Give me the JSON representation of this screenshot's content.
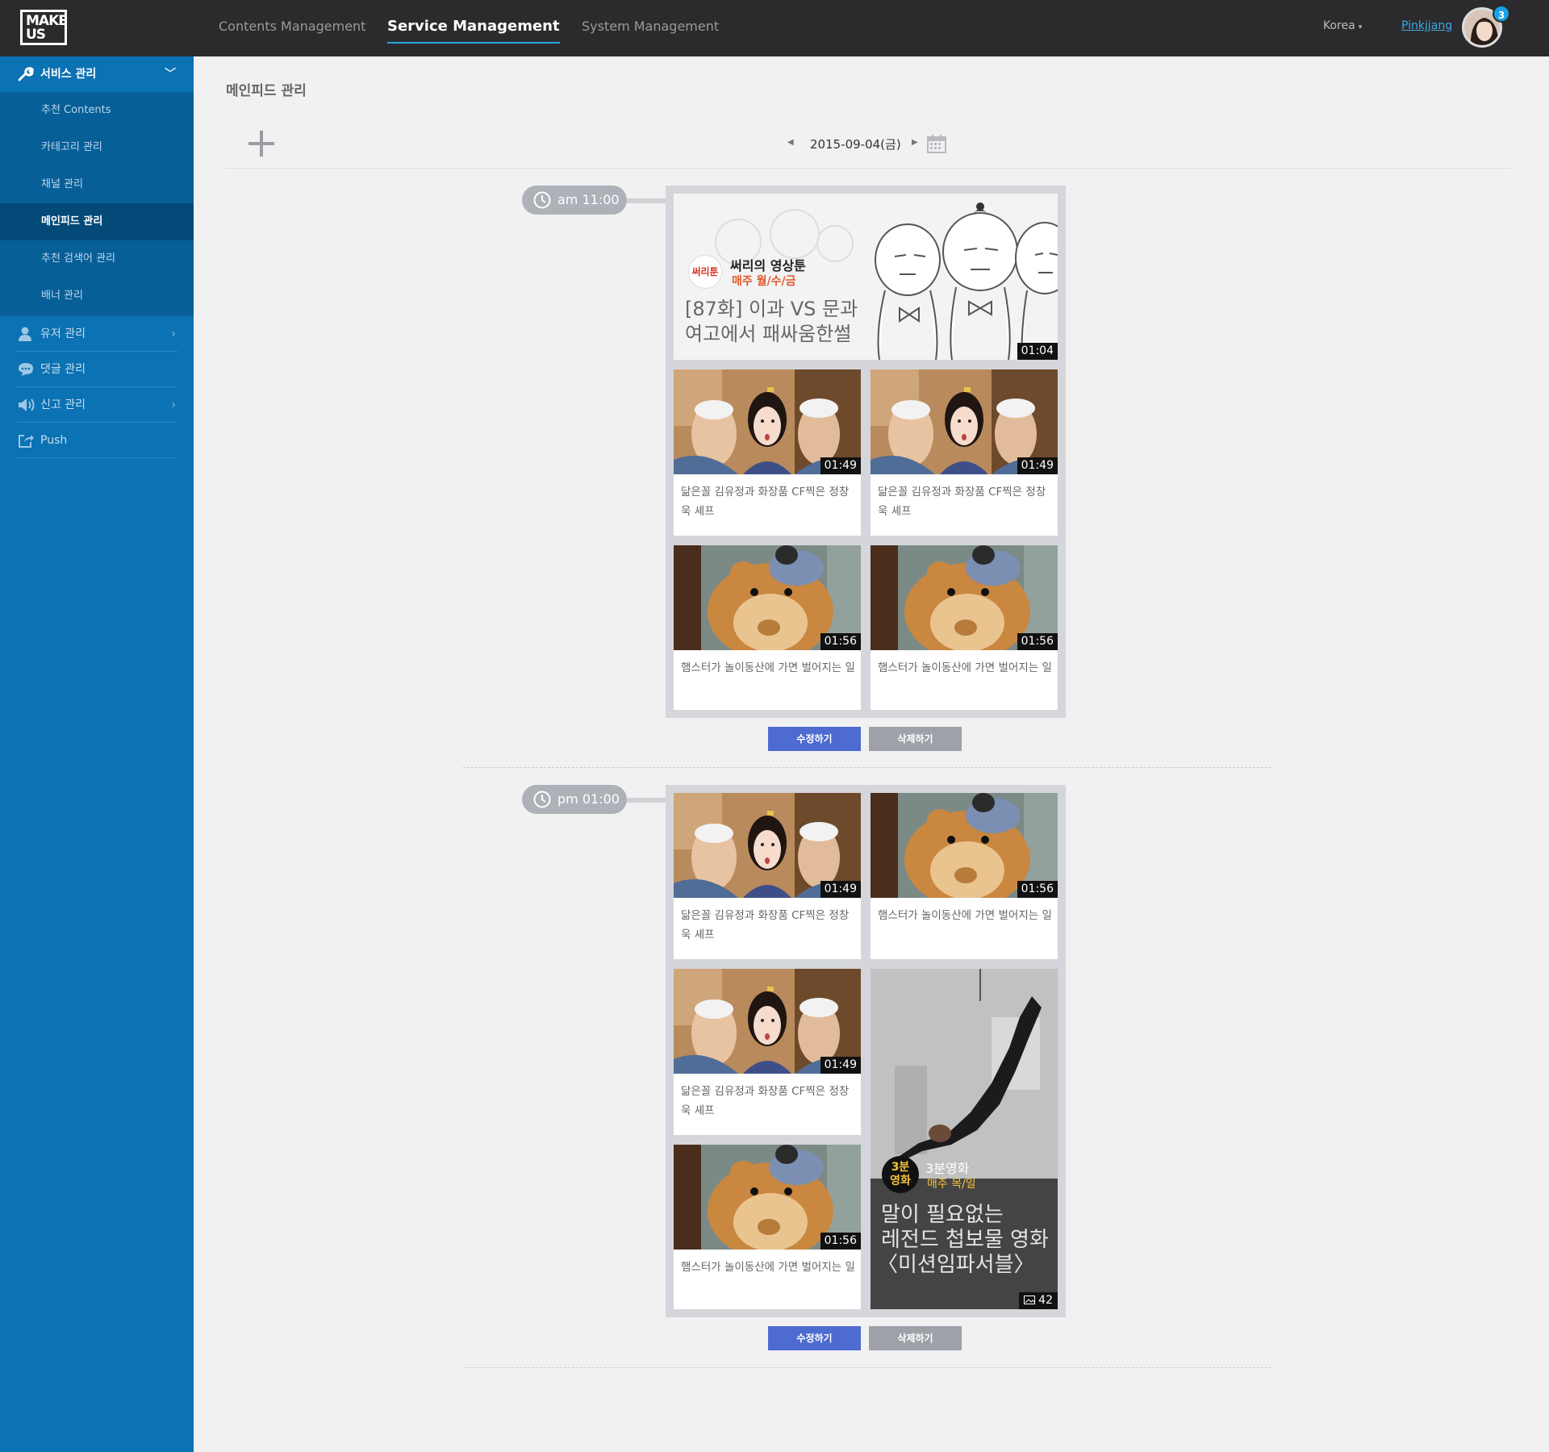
{
  "app": {
    "logo_line1": "MAKE",
    "logo_line2": "US"
  },
  "topnav": {
    "items": [
      "Contents Management",
      "Service Management",
      "System Management"
    ],
    "active": "Service Management",
    "region": "Korea",
    "region_caret": "▾",
    "username": "Pinkjjang",
    "notification_count": "3"
  },
  "sidebar": {
    "section_title": "서비스 관리",
    "section_chevron": "﹀",
    "sub_items": [
      "추천 Contents",
      "카테고리 관리",
      "채널 관리",
      "메인피드 관리",
      "추천 검색어 관리",
      "배너 관리"
    ],
    "active_sub": "메인피드 관리",
    "items": [
      "유저 관리",
      "댓글 관리",
      "신고 관리",
      "Push"
    ],
    "item_chevron": "›",
    "accent": "#0b72b3"
  },
  "main": {
    "title": "메인피드 관리",
    "date": "2015-09-04(금)",
    "prev": "◀",
    "next": "▶",
    "edit_label": "수정하기",
    "delete_label": "삭제하기"
  },
  "feeds": [
    {
      "time": "am 11:00",
      "hero": {
        "logo": "써리툰",
        "name": "써리의 영상툰",
        "schedule": "매주 월/수/금",
        "title_line1": "[87화] 이과 VS 문과",
        "title_line2": "여고에서 패싸움한썰",
        "duration": "01:04"
      },
      "cards": [
        {
          "title": "닮은꼴 김유정과 화장품 CF찍은 정창욱 셰프",
          "duration": "01:49",
          "image": "chef-cf"
        },
        {
          "title": "닮은꼴 김유정과 화장품 CF찍은 정창욱 셰프",
          "duration": "01:49",
          "image": "chef-cf"
        },
        {
          "title": "햄스터가 놀이동산에 가면 벌어지는 일",
          "duration": "01:56",
          "image": "hamster"
        },
        {
          "title": "햄스터가 놀이동산에 가면 벌어지는 일",
          "duration": "01:56",
          "image": "hamster"
        }
      ]
    },
    {
      "time": "pm 01:00",
      "cards": [
        {
          "title": "닮은꼴 김유정과 화장품 CF찍은 정창욱 셰프",
          "duration": "01:49",
          "image": "chef-cf"
        },
        {
          "title": "햄스터가 놀이동산에 가면 벌어지는 일",
          "duration": "01:56",
          "image": "hamster"
        },
        {
          "title": "닮은꼴 김유정과 화장품 CF찍은 정창욱 셰프",
          "duration": "01:49",
          "image": "chef-cf"
        },
        {
          "title": "햄스터가 놀이동산에 가면 벌어지는 일",
          "duration": "01:56",
          "image": "hamster"
        }
      ],
      "feature": {
        "logo_line1": "3분",
        "logo_line2": "영화",
        "name": "3분영화",
        "schedule": "매주 목/일",
        "title_line1": "말이 필요없는",
        "title_line2": "레전드 첩보물 영화",
        "title_line3": "〈미션임파서블〉",
        "count": "42"
      }
    }
  ]
}
